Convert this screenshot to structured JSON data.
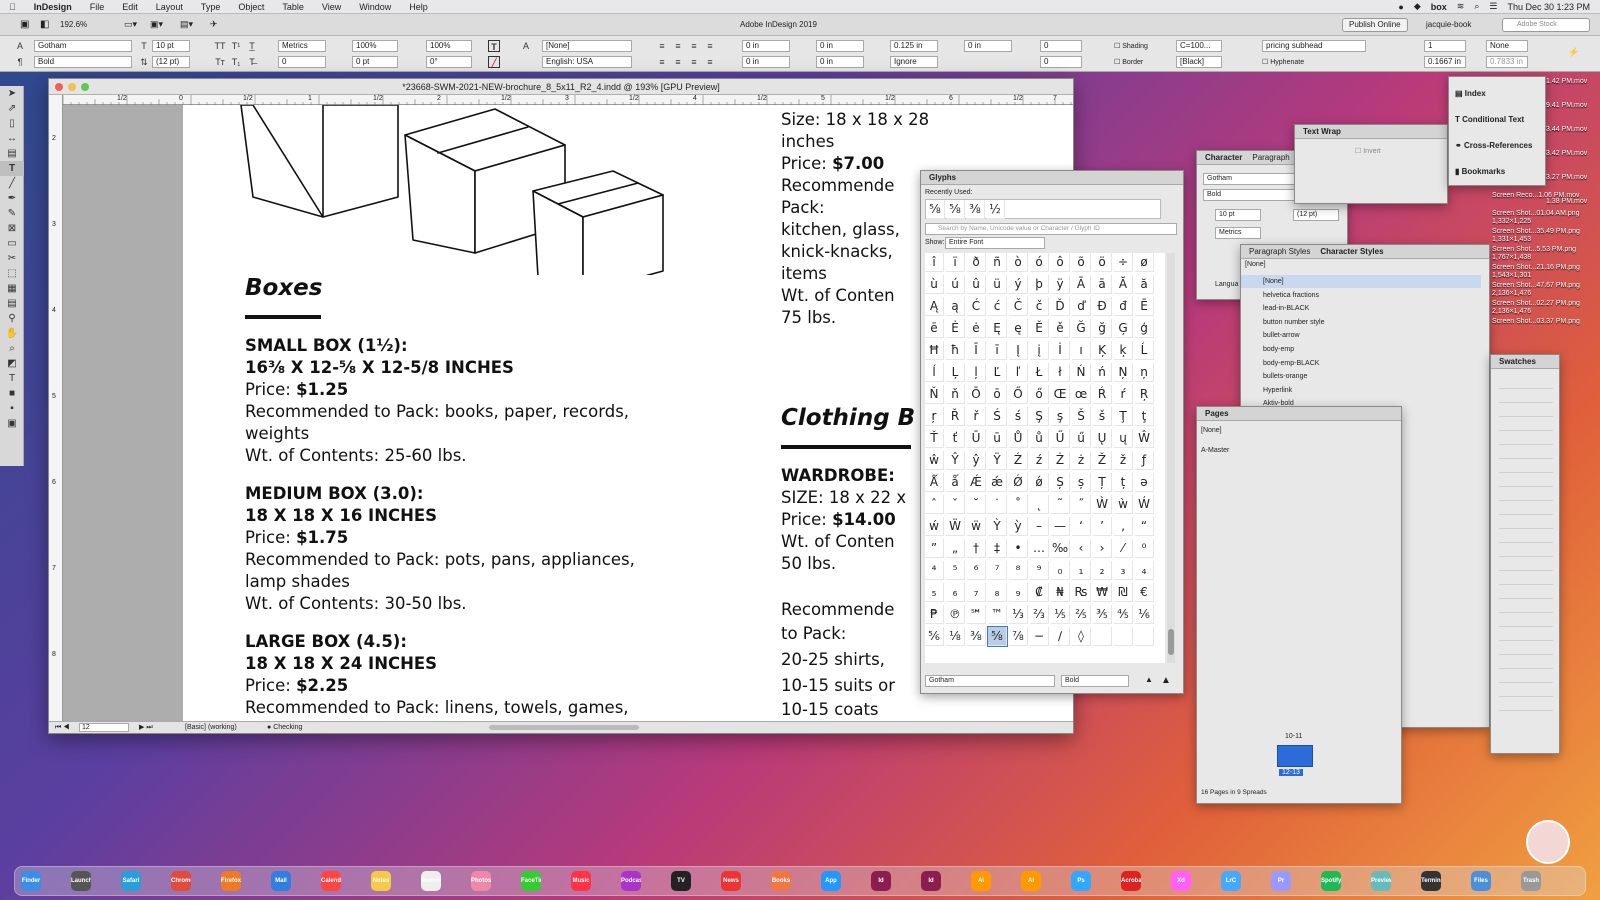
{
  "menubar": {
    "apple": "",
    "app": "InDesign",
    "items": [
      "File",
      "Edit",
      "Layout",
      "Type",
      "Object",
      "Table",
      "View",
      "Window",
      "Help"
    ],
    "clock": "Thu Dec 30  1:23 PM",
    "box": "box"
  },
  "appbar": {
    "zoom": "192.6%",
    "title": "Adobe InDesign 2019",
    "publish": "Publish Online",
    "user": "jacquie-book",
    "stock_placeholder": "Adobe Stock"
  },
  "control": {
    "font": "Gotham",
    "style": "Bold",
    "size": "10 pt",
    "leading": "(12 pt)",
    "kerning": "Metrics",
    "tracking": "0",
    "hscale": "100%",
    "vscale": "100%",
    "baseline": "0 pt",
    "skew": "0°",
    "charstyle": "[None]",
    "language": "English: USA",
    "indent1": "0 in",
    "indent2": "0 in",
    "indent3": "0 in",
    "indent4": "0 in",
    "space1": "0.125 in",
    "space2": "0 in",
    "dropcap1": "0",
    "dropcap2": "0",
    "shading": "Shading",
    "shading_color": "C=100...",
    "border": "Border",
    "border_color": "[Black]",
    "ignore": "Ignore",
    "parastyle": "pricing subhead",
    "hyphenate": "Hyphenate",
    "cols": "1",
    "gutter": "0.1667 in",
    "none": "None",
    "gutter2": "0.7833 in"
  },
  "document": {
    "title": "*23668-SWM-2021-NEW-brochure_8_5x11_R2_4.indd @ 193% [GPU Preview]",
    "ruler_marks": [
      "1/2",
      "0",
      "1/2",
      "1",
      "1/2",
      "2",
      "1/2",
      "3",
      "1/2",
      "4",
      "1/2",
      "5",
      "1/2",
      "6",
      "1/2",
      "7"
    ],
    "vruler_marks": [
      "2",
      "3",
      "4",
      "5",
      "6",
      "7",
      "8"
    ],
    "boxes_heading": "Boxes",
    "small_title": "SMALL BOX (1½):",
    "small_dims": "16⅜ X 12-⅝ X 12-5/8 INCHES",
    "small_price_label": "Price: ",
    "small_price": "$1.25",
    "small_rec": "Recommended to Pack: books, paper, records,",
    "small_rec2": "weights",
    "small_wt": "Wt. of Contents: 25-60 lbs.",
    "medium_title": "MEDIUM BOX (3.0):",
    "medium_dims": "18 X 18 X 16 INCHES",
    "medium_price_label": "Price: ",
    "medium_price": "$1.75",
    "medium_rec": "Recommended to Pack: pots, pans, appliances,",
    "medium_rec2": "lamp shades",
    "medium_wt": "Wt. of Contents: 30-50 lbs.",
    "large_title": "LARGE BOX (4.5):",
    "large_dims": "18 X 18 X 24 INCHES",
    "large_price_label": "Price: ",
    "large_price": "$2.25",
    "large_rec": "Recommended to Pack: linens, towels, games,",
    "right_size1": "Size: 18 x 18 x 28",
    "right_size2": "inches",
    "right_price_label": "Price: ",
    "right_price": "$7.00",
    "right_rec1": "Recommende",
    "right_rec2": "Pack:",
    "right_rec3": "kitchen, glass,",
    "right_rec4": "knick-knacks,",
    "right_rec5": "items",
    "right_wt1": "Wt. of Conten",
    "right_wt2": "75 lbs.",
    "clothing_heading": "Clothing B",
    "wardrobe_title": "WARDROBE:",
    "wardrobe_size": "SIZE: 18 x 22 x",
    "wardrobe_price_label": "Price: ",
    "wardrobe_price": "$14.00",
    "wardrobe_wt1": "Wt. of Conten",
    "wardrobe_wt2": "50 lbs.",
    "wardrobe_rec1": "Recommende",
    "wardrobe_rec2": "to Pack:",
    "wardrobe_rec3": "20-25 shirts,",
    "wardrobe_rec4": "10-15 suits or",
    "wardrobe_rec5": "10-15 coats",
    "status_page": "12",
    "status_style": "[Basic] (working)",
    "status_preflight": "Checking"
  },
  "glyphs": {
    "title": "Glyphs",
    "recent_label": "Recently Used:",
    "recent": [
      "⅝",
      "⅝",
      "⅜",
      "½"
    ],
    "search_placeholder": "Search by Name, Unicode value or Character / Glyph ID",
    "show_label": "Show:",
    "show_value": "Entire Font",
    "grid": [
      [
        "î",
        "ï",
        "ð",
        "ñ",
        "ò",
        "ó",
        "ô",
        "õ",
        "ö",
        "÷",
        "ø"
      ],
      [
        "ù",
        "ú",
        "û",
        "ü",
        "ý",
        "þ",
        "ÿ",
        "Ā",
        "ā",
        "Ă",
        "ă"
      ],
      [
        "Ą",
        "ą",
        "Ć",
        "ć",
        "Č",
        "č",
        "Ď",
        "ď",
        "Ð",
        "đ",
        "Ē"
      ],
      [
        "ē",
        "Ė",
        "ė",
        "Ę",
        "ę",
        "Ě",
        "ě",
        "Ğ",
        "ğ",
        "Ģ",
        "ģ"
      ],
      [
        "Ħ",
        "ħ",
        "Ī",
        "ī",
        "Į",
        "į",
        "İ",
        "ı",
        "Ķ",
        "ķ",
        "Ĺ"
      ],
      [
        "ĺ",
        "Ļ",
        "ļ",
        "Ľ",
        "ľ",
        "Ł",
        "ł",
        "Ń",
        "ń",
        "Ņ",
        "ņ"
      ],
      [
        "Ň",
        "ň",
        "Ō",
        "ō",
        "Ő",
        "ő",
        "Œ",
        "œ",
        "Ŕ",
        "ŕ",
        "Ŗ"
      ],
      [
        "ŗ",
        "Ř",
        "ř",
        "Ś",
        "ś",
        "Ş",
        "ş",
        "Š",
        "š",
        "Ţ",
        "ţ"
      ],
      [
        "Ť",
        "ť",
        "Ū",
        "ū",
        "Ů",
        "ů",
        "Ű",
        "ű",
        "Ų",
        "ų",
        "Ŵ"
      ],
      [
        "ŵ",
        "Ŷ",
        "ŷ",
        "Ÿ",
        "Ź",
        "ź",
        "Ż",
        "ż",
        "Ž",
        "ž",
        "ƒ"
      ],
      [
        "Ǻ",
        "ǻ",
        "Ǽ",
        "ǽ",
        "Ǿ",
        "ǿ",
        "Ș",
        "ș",
        "Ț",
        "ț",
        "ə"
      ],
      [
        "ˆ",
        "ˇ",
        "˘",
        "˙",
        "˚",
        "˛",
        "˜",
        "˝",
        "Ẁ",
        "ẁ",
        "Ẃ"
      ],
      [
        "ẃ",
        "Ẅ",
        "ẅ",
        "Ỳ",
        "ỳ",
        "–",
        "—",
        "‘",
        "’",
        "‚",
        "“"
      ],
      [
        "”",
        "„",
        "†",
        "‡",
        "•",
        "…",
        "‰",
        "‹",
        "›",
        "⁄",
        "⁰"
      ],
      [
        "⁴",
        "⁵",
        "⁶",
        "⁷",
        "⁸",
        "⁹",
        "₀",
        "₁",
        "₂",
        "₃",
        "₄"
      ],
      [
        "₅",
        "₆",
        "₇",
        "₈",
        "₉",
        "₡",
        "₦",
        "₨",
        "₩",
        "₪",
        "€"
      ],
      [
        "₱",
        "℗",
        "℠",
        "™",
        "⅓",
        "⅔",
        "⅕",
        "⅖",
        "⅗",
        "⅘",
        "⅙"
      ],
      [
        "⅚",
        "⅛",
        "⅜",
        "⅝",
        "⅞",
        "−",
        "∕",
        "◊",
        "",
        "",
        ""
      ]
    ],
    "selected": "⅝",
    "font": "Gotham",
    "style": "Bold"
  },
  "character_panel": {
    "tabs": [
      "Character",
      "Paragraph"
    ],
    "font": "Gotham",
    "style": "Bold",
    "size": "10 pt",
    "leading": "(12 pt)",
    "kerning": "Metrics",
    "lang": "Langua"
  },
  "textwrap": {
    "title": "Text Wrap",
    "invert": "Invert"
  },
  "right_dock": {
    "items": [
      "Index",
      "Conditional Text",
      "Cross-References",
      "Bookmarks"
    ]
  },
  "styles_panel": {
    "tabs": [
      "Paragraph Styles",
      "Character Styles"
    ],
    "current": "[None]",
    "items": [
      "[None]",
      "helvetica fractions",
      "lead-in-BLACK",
      "button number style",
      "bullet-arrow",
      "body-emp",
      "body-emp-BLACK",
      "bullets-orange",
      "Hyperlink",
      "Aktiv-bold",
      "emp",
      "emp-K",
      "body text-Koboto LT IT",
      "Normal",
      "hints-number",
      "price list-bold price",
      "B2-emp",
      "B3-emp"
    ]
  },
  "pages_panel": {
    "title": "Pages",
    "none": "[None]",
    "master": "A-Master",
    "spread_label": "10-11",
    "active_label": "12-13",
    "footer": "16 Pages in 9 Spreads"
  },
  "swatches": {
    "title": "Swatches"
  },
  "desktop_files": [
    {
      "name": "Screen Reco...1.06 PM.mov",
      "size": ""
    },
    {
      "name": "Screen Shot...01.04 AM.png",
      "size": "1,332×1,225"
    },
    {
      "name": "Screen Shot...35.49 PM.png",
      "size": "1,331×1,453"
    },
    {
      "name": "Screen Shot...5.53 PM.png",
      "size": "1,767×1,438"
    },
    {
      "name": "Screen Shot...21.16 PM.png",
      "size": "1,543×1,301"
    },
    {
      "name": "Screen Shot...47.67 PM.png",
      "size": "2,136×1,476"
    },
    {
      "name": "Screen Shot...02.27 PM.png",
      "size": "2,136×1,476"
    },
    {
      "name": "Screen Shot...03.37 PM.png",
      "size": ""
    }
  ],
  "desktop_times": [
    "1.42 PM.mov",
    "9.41 PM.mov",
    "3.44 PM.mov",
    "3.42 PM.mov",
    "3.27 PM.mov",
    "1.38 PM.mov"
  ],
  "dock_icons": [
    "Finder",
    "Launchpad",
    "Safari",
    "Chrome",
    "Firefox",
    "Mail",
    "Calendar",
    "Notes",
    "Reminders",
    "Photos",
    "FaceTime",
    "Music",
    "Podcasts",
    "TV",
    "News",
    "Books",
    "App Store",
    "Id",
    "Id",
    "Ai",
    "Ai",
    "Ps",
    "Acrobat",
    "Xd",
    "LrC",
    "Pr",
    "Spotify",
    "Preview",
    "Terminal",
    "Files",
    "Trash"
  ]
}
